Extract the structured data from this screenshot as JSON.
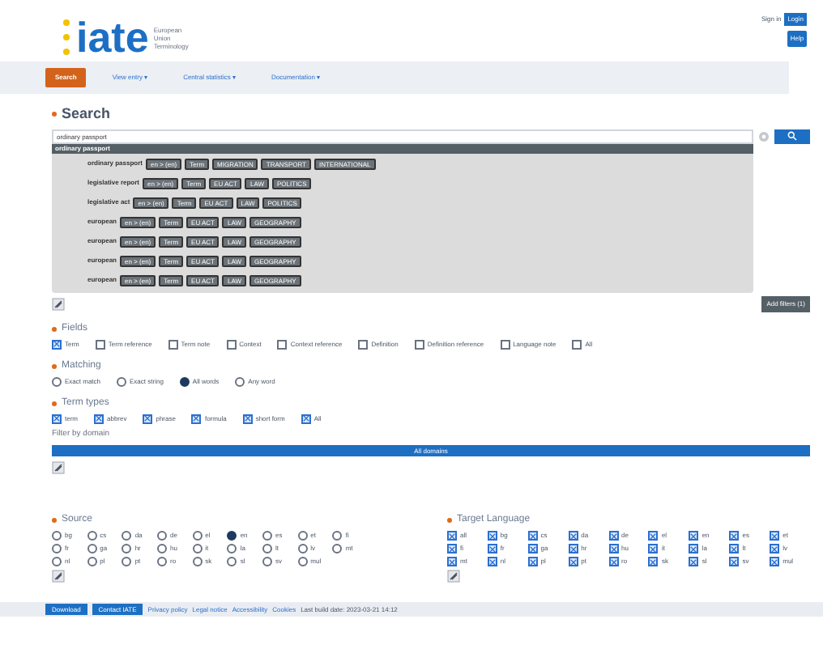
{
  "header": {
    "logo": "iate",
    "tagline": [
      "European",
      "Union",
      "Terminology"
    ],
    "sign_in": "Sign in",
    "login": "Login",
    "chat": "Help"
  },
  "nav": [
    {
      "label": "Search",
      "selected": true
    },
    {
      "label": "View entry ▾",
      "selected": false
    },
    {
      "label": "Central statistics ▾",
      "selected": false
    },
    {
      "label": "Documentation ▾",
      "selected": false
    }
  ],
  "search": {
    "heading": "Search",
    "value": "ordinary passport",
    "suggest_header": "ordinary passport",
    "suggestions": [
      {
        "term": "ordinary passport",
        "tags": [
          "en > (en)",
          "Term",
          "MIGRATION",
          "TRANSPORT",
          "INTERNATIONAL"
        ]
      },
      {
        "term": "legislative report",
        "tags": [
          "en > (en)",
          "Term",
          "EU ACT",
          "LAW",
          "POLITICS"
        ]
      },
      {
        "term": "legislative act",
        "tags": [
          "en > (en)",
          "Term",
          "EU ACT",
          "LAW",
          "POLITICS"
        ]
      },
      {
        "term": "european",
        "tags": [
          "en > (en)",
          "Term",
          "EU ACT",
          "LAW",
          "GEOGRAPHY"
        ]
      },
      {
        "term": "european",
        "tags": [
          "en > (en)",
          "Term",
          "EU ACT",
          "LAW",
          "GEOGRAPHY"
        ]
      },
      {
        "term": "european",
        "tags": [
          "en > (en)",
          "Term",
          "EU ACT",
          "LAW",
          "GEOGRAPHY"
        ]
      },
      {
        "term": "european",
        "tags": [
          "en > (en)",
          "Term",
          "EU ACT",
          "LAW",
          "GEOGRAPHY"
        ]
      }
    ],
    "add_filters": "Add filters (1)"
  },
  "fields": {
    "label": "Fields",
    "options": [
      {
        "label": "Term",
        "checked": true
      },
      {
        "label": "Term reference",
        "checked": false
      },
      {
        "label": "Term note",
        "checked": false
      },
      {
        "label": "Context",
        "checked": false
      },
      {
        "label": "Context reference",
        "checked": false
      },
      {
        "label": "Definition",
        "checked": false
      },
      {
        "label": "Definition reference",
        "checked": false
      },
      {
        "label": "Language note",
        "checked": false
      },
      {
        "label": "All",
        "checked": false
      }
    ]
  },
  "matching": {
    "label": "Matching",
    "options": [
      {
        "label": "Exact match",
        "selected": false
      },
      {
        "label": "Exact string",
        "selected": false
      },
      {
        "label": "All words",
        "selected": true
      },
      {
        "label": "Any word",
        "selected": false
      }
    ]
  },
  "term_types": {
    "label": "Term types",
    "options": [
      {
        "label": "term",
        "checked": true
      },
      {
        "label": "abbrev",
        "checked": true
      },
      {
        "label": "phrase",
        "checked": true
      },
      {
        "label": "formula",
        "checked": true
      },
      {
        "label": "short form",
        "checked": true
      },
      {
        "label": "All",
        "checked": true
      }
    ]
  },
  "domain": {
    "label": "Filter by domain",
    "button": "All domains"
  },
  "source": {
    "label": "Source",
    "languages": [
      {
        "code": "bg",
        "selected": false
      },
      {
        "code": "cs",
        "selected": false
      },
      {
        "code": "da",
        "selected": false
      },
      {
        "code": "de",
        "selected": false
      },
      {
        "code": "el",
        "selected": false
      },
      {
        "code": "en",
        "selected": true
      },
      {
        "code": "es",
        "selected": false
      },
      {
        "code": "et",
        "selected": false
      },
      {
        "code": "fi",
        "selected": false
      },
      {
        "code": "fr",
        "selected": false
      },
      {
        "code": "ga",
        "selected": false
      },
      {
        "code": "hr",
        "selected": false
      },
      {
        "code": "hu",
        "selected": false
      },
      {
        "code": "it",
        "selected": false
      },
      {
        "code": "la",
        "selected": false
      },
      {
        "code": "lt",
        "selected": false
      },
      {
        "code": "lv",
        "selected": false
      },
      {
        "code": "mt",
        "selected": false
      },
      {
        "code": "nl",
        "selected": false
      },
      {
        "code": "pl",
        "selected": false
      },
      {
        "code": "pt",
        "selected": false
      },
      {
        "code": "ro",
        "selected": false
      },
      {
        "code": "sk",
        "selected": false
      },
      {
        "code": "sl",
        "selected": false
      },
      {
        "code": "sv",
        "selected": false
      },
      {
        "code": "mul",
        "selected": false
      }
    ]
  },
  "target": {
    "label": "Target Language",
    "languages": [
      {
        "code": "all",
        "checked": true
      },
      {
        "code": "bg",
        "checked": true
      },
      {
        "code": "cs",
        "checked": true
      },
      {
        "code": "da",
        "checked": true
      },
      {
        "code": "de",
        "checked": true
      },
      {
        "code": "el",
        "checked": true
      },
      {
        "code": "en",
        "checked": true
      },
      {
        "code": "es",
        "checked": true
      },
      {
        "code": "et",
        "checked": true
      },
      {
        "code": "fi",
        "checked": true
      },
      {
        "code": "fr",
        "checked": true
      },
      {
        "code": "ga",
        "checked": true
      },
      {
        "code": "hr",
        "checked": true
      },
      {
        "code": "hu",
        "checked": true
      },
      {
        "code": "it",
        "checked": true
      },
      {
        "code": "la",
        "checked": true
      },
      {
        "code": "lt",
        "checked": true
      },
      {
        "code": "lv",
        "checked": true
      },
      {
        "code": "mt",
        "checked": true
      },
      {
        "code": "nl",
        "checked": true
      },
      {
        "code": "pl",
        "checked": true
      },
      {
        "code": "pt",
        "checked": true
      },
      {
        "code": "ro",
        "checked": true
      },
      {
        "code": "sk",
        "checked": true
      },
      {
        "code": "sl",
        "checked": true
      },
      {
        "code": "sv",
        "checked": true
      },
      {
        "code": "mul",
        "checked": true
      }
    ]
  },
  "footer": {
    "buttons": [
      "Download",
      "Contact IATE"
    ],
    "links": [
      "Privacy policy",
      "Legal notice",
      "Accessibility",
      "Cookies"
    ],
    "version": "Last build date: 2023-03-21 14:12"
  }
}
